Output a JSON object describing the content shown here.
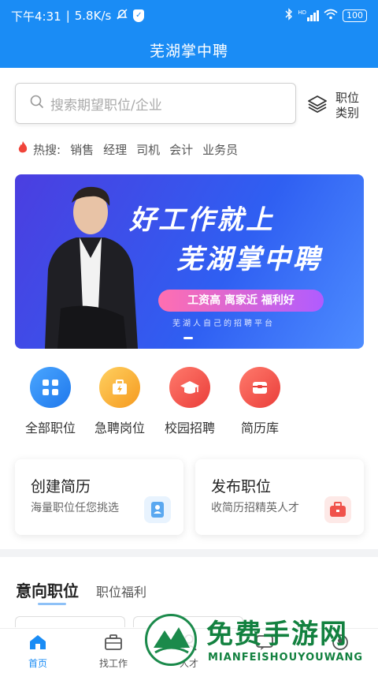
{
  "status_bar": {
    "time": "下午4:31",
    "speed": "5.8K/s",
    "network": "HD",
    "battery": "100"
  },
  "header": {
    "title": "芜湖掌中聘"
  },
  "search": {
    "placeholder": "搜索期望职位/企业"
  },
  "category": {
    "line1": "职位",
    "line2": "类别"
  },
  "hot_search": {
    "label": "热搜:",
    "terms": [
      "销售",
      "经理",
      "司机",
      "会计",
      "业务员"
    ]
  },
  "banner": {
    "line1": "好工作就上",
    "line2": "芜湖掌中聘",
    "pill": "工资高  离家近  福利好",
    "tagline": "芜湖人自己的招聘平台"
  },
  "quick_entries": [
    {
      "label": "全部职位",
      "icon": "grid-icon",
      "color": "#2f8df5"
    },
    {
      "label": "急聘岗位",
      "icon": "briefcase-bolt-icon",
      "color": "#f5a623"
    },
    {
      "label": "校园招聘",
      "icon": "graduation-cap-icon",
      "color": "#f0524b"
    },
    {
      "label": "简历库",
      "icon": "resume-box-icon",
      "color": "#f0524b"
    }
  ],
  "cards": [
    {
      "title": "创建简历",
      "subtitle": "海量职位任您挑选",
      "icon": "resume-icon",
      "color": "#5aa8f0"
    },
    {
      "title": "发布职位",
      "subtitle": "收简历招精英人才",
      "icon": "job-bag-icon",
      "color": "#f0524b"
    }
  ],
  "section_tabs": {
    "active": "意向职位",
    "other": "职位福利"
  },
  "bottom_nav": [
    {
      "label": "首页",
      "icon": "home-icon",
      "active": true
    },
    {
      "label": "找工作",
      "icon": "briefcase-icon",
      "active": false
    },
    {
      "label": "人才",
      "icon": "person-icon",
      "active": false
    },
    {
      "label": "",
      "icon": "message-icon",
      "active": false
    },
    {
      "label": "",
      "icon": "user-icon",
      "active": false
    }
  ],
  "watermark": {
    "title": "免费手游网",
    "subtitle": "MIANFEISHOUYOUWANG"
  },
  "colors": {
    "brand_blue": "#1a8cf5",
    "watermark_green": "#12813f"
  }
}
